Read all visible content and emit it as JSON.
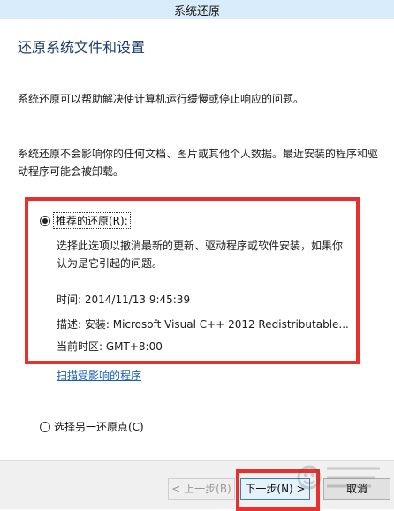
{
  "window": {
    "title": "系统还原"
  },
  "page": {
    "heading": "还原系统文件和设置",
    "intro": "系统还原可以帮助解决使计算机运行缓慢或停止响应的问题。",
    "notice": "系统还原不会影响你的任何文档、图片或其他个人数据。最近安装的程序和驱动程序可能会被卸载。"
  },
  "recommended": {
    "label": "推荐的还原(R):",
    "selected": true,
    "description": "选择此选项以撤消最新的更新、驱动程序或软件安装，如果你认为是它引起的问题。",
    "time": "时间: 2014/11/13 9:45:39",
    "desc": "描述: 安装: Microsoft Visual C++ 2012 Redistributable...",
    "timezone": "当前时区: GMT+8:00"
  },
  "scan_link": "扫描受影响的程序",
  "other": {
    "label": "选择另一还原点(C)",
    "selected": false
  },
  "buttons": {
    "back": "< 上一步(B)",
    "next": "下一步(N) >",
    "cancel": "取消"
  },
  "colors": {
    "highlight": "#e8312f",
    "link": "#1a5fb4",
    "titlebar": "#d9ecfb"
  }
}
